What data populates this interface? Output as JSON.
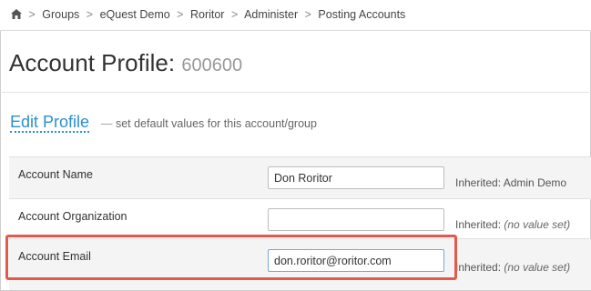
{
  "breadcrumb": {
    "items": [
      "Groups",
      "eQuest Demo",
      "Roritor",
      "Administer",
      "Posting Accounts"
    ],
    "separator": ">"
  },
  "page": {
    "title": "Account Profile:",
    "account_id": "600600"
  },
  "edit_profile": {
    "label": "Edit Profile",
    "dash": "—",
    "subtitle": "set default values for this account/group"
  },
  "fields": [
    {
      "label": "Account Name",
      "value": "Don Roritor",
      "inherited_prefix": "Inherited:",
      "inherited_value": "Admin Demo",
      "inherited_note": ""
    },
    {
      "label": "Account Organization",
      "value": "",
      "inherited_prefix": "Inherited:",
      "inherited_value": "",
      "inherited_note": "(no value set)"
    },
    {
      "label": "Account Email",
      "value": "don.roritor@roritor.com",
      "inherited_prefix": "Inherited:",
      "inherited_value": "",
      "inherited_note": "(no value set)"
    }
  ],
  "colors": {
    "link": "#2a8fd1",
    "highlight": "#e05a4d"
  },
  "icons": {
    "home": "home-icon"
  }
}
